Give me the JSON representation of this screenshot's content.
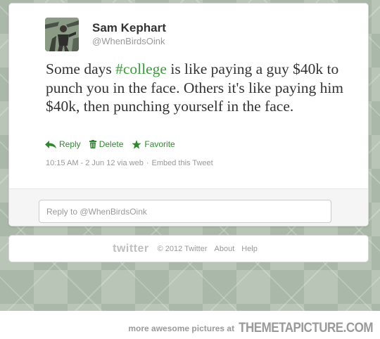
{
  "tweet": {
    "author_name": "Sam Kephart",
    "author_handle": "@WhenBirdsOink",
    "text_before": "Some days ",
    "hashtag": "#college",
    "text_after": " is like paying a guy $40k to punch you in the face. Others it's like paying him $40k, then punching yourself in the face.",
    "actions": {
      "reply": "Reply",
      "delete": "Delete",
      "favorite": "Favorite"
    },
    "timestamp": "10:15 AM - 2 Jun 12 via web",
    "meta_separator": "·",
    "embed": "Embed this Tweet",
    "reply_placeholder": "Reply to @WhenBirdsOink"
  },
  "footer": {
    "logo": "twitter",
    "copyright": "© 2012 Twitter",
    "about": "About",
    "help": "Help"
  },
  "credit": {
    "text": "more awesome pictures at",
    "site": "THEMETAPICTURE.COM"
  },
  "colors": {
    "accent_green": "#3c9b3c",
    "background_pattern": "#a9b8a8"
  }
}
